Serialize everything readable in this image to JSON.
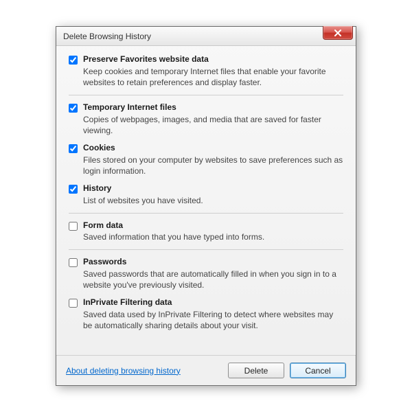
{
  "window": {
    "title": "Delete Browsing History"
  },
  "options": [
    {
      "checked": true,
      "title": "Preserve Favorites website data",
      "desc": "Keep cookies and temporary Internet files that enable your favorite websites to retain preferences and display faster."
    },
    {
      "checked": true,
      "title": "Temporary Internet files",
      "desc": "Copies of webpages, images, and media that are saved for faster viewing."
    },
    {
      "checked": true,
      "title": "Cookies",
      "desc": "Files stored on your computer by websites to save preferences such as login information."
    },
    {
      "checked": true,
      "title": "History",
      "desc": "List of websites you have visited."
    },
    {
      "checked": false,
      "title": "Form data",
      "desc": "Saved information that you have typed into forms."
    },
    {
      "checked": false,
      "title": "Passwords",
      "desc": "Saved passwords that are automatically filled in when you sign in to a website you've previously visited."
    },
    {
      "checked": false,
      "title": "InPrivate Filtering data",
      "desc": "Saved data used by InPrivate Filtering to detect where websites may be automatically sharing details about your visit."
    }
  ],
  "footer": {
    "help_link": "About deleting browsing history",
    "delete_label": "Delete",
    "cancel_label": "Cancel"
  }
}
